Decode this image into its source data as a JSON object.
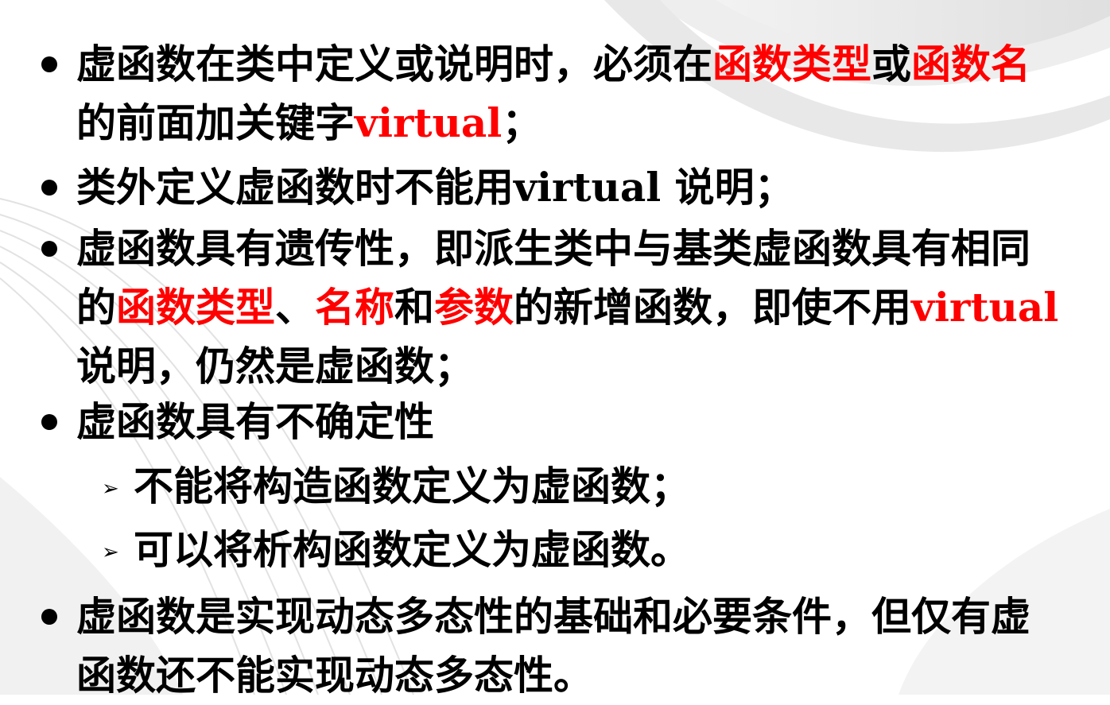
{
  "slide": {
    "bullets": [
      {
        "line1": {
          "t1": "虚函数在类中定义或说明时，必须在",
          "r1": "函数类型",
          "t2": "或",
          "r2": "函数名"
        },
        "line2": {
          "t1": "的前面加关键字",
          "r1": "virtual",
          "t2": "；"
        }
      },
      {
        "line1": {
          "t1": "类外定义虚函数时不能用virtual 说明；"
        }
      },
      {
        "line1": {
          "t1": "虚函数具有遗传性，即派生类中与基类虚函数具有相同"
        },
        "line2": {
          "t1": "的",
          "r1": "函数类型",
          "t2": "、",
          "r2": "名称",
          "t3": "和",
          "r3": "参数",
          "t4": "的新增函数，即使不用",
          "r4": "virtual"
        },
        "line3": {
          "t1": "说明，仍然是虚函数；"
        }
      },
      {
        "line1": {
          "t1": "虚函数具有不确定性"
        },
        "subs": [
          "不能将构造函数定义为虚函数；",
          "可以将析构函数定义为虚函数。"
        ]
      },
      {
        "line1": {
          "t1": "虚函数是实现动态多态性的基础和必要条件，但仅有虚"
        },
        "line2": {
          "t1": "函数还不能实现动态多态性。"
        }
      }
    ],
    "colors": {
      "text": "#000000",
      "highlight": "#ff0000",
      "background": "#ffffff",
      "decoration": "#e6e6e6"
    },
    "icons": {
      "bullet": "filled-circle-icon",
      "sub_bullet": "arrowhead-icon"
    }
  }
}
